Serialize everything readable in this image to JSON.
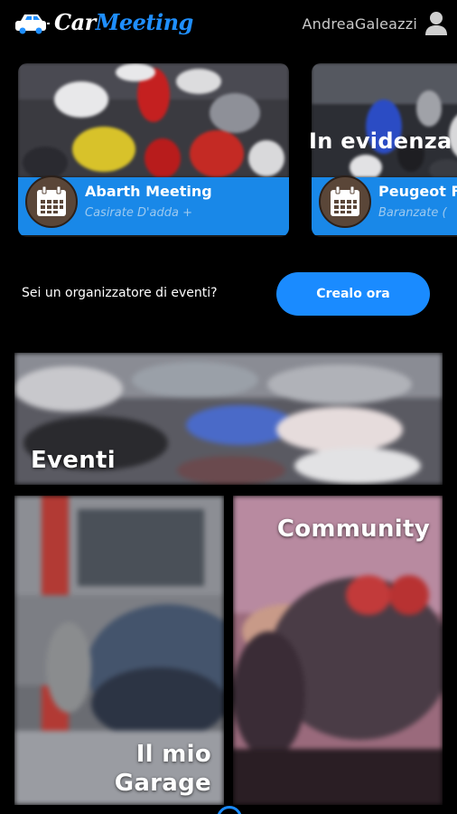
{
  "header": {
    "logo_word1": "Car",
    "logo_word2": "Meeting",
    "username": "AndreaGaleazzi"
  },
  "featured": {
    "title": "In evidenza",
    "events": [
      {
        "name": "Abarth Meeting",
        "place": "Casirate D'adda +",
        "icon": "calendar-icon"
      },
      {
        "name": "Peugeot F",
        "place": "Baranzate (",
        "icon": "calendar-icon"
      }
    ]
  },
  "organizer": {
    "prompt": "Sei un organizzatore di eventi?",
    "button_label": "Crealo ora"
  },
  "tiles": {
    "eventi": "Eventi",
    "garage_line1": "Il mio",
    "garage_line2": "Garage",
    "community": "Community"
  },
  "colors": {
    "accent": "#1a8bff",
    "card_bar": "#1988e8",
    "background": "#000000"
  }
}
